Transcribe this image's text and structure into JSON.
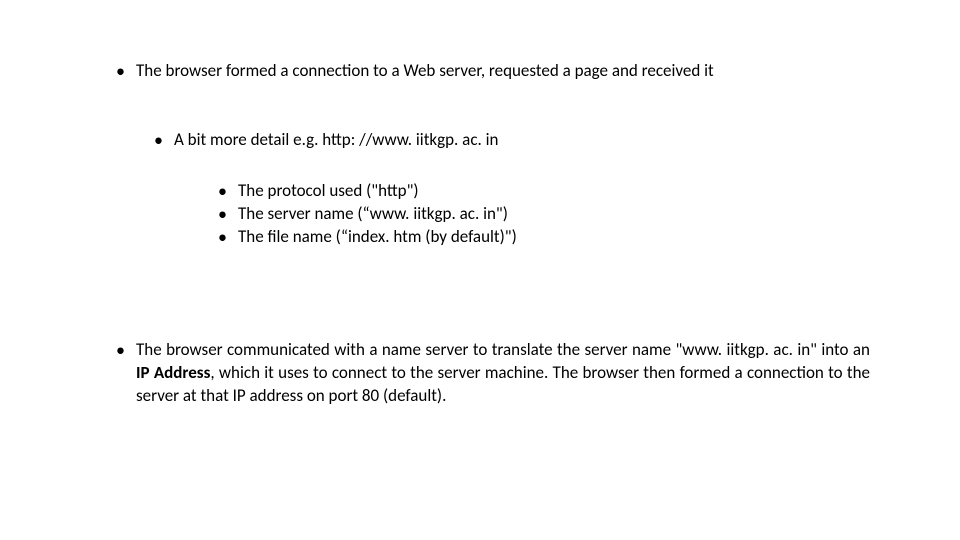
{
  "content": {
    "bullet1": "The browser formed a connection to a Web server, requested a page and received it",
    "sub1": "A bit more detail e.g. http: //www. iitkgp. ac. in",
    "subsub": {
      "a": "The protocol used (\"http\")",
      "b": "The server name (“www. iitkgp. ac. in\")",
      "c": "The file name (“index. htm (by default)\")"
    },
    "bullet2": {
      "pre": "The browser communicated with a name server to translate the server name \"www. iitkgp. ac. in\" into an ",
      "bold": "IP Address",
      "post": ", which it uses to connect to the server machine. The browser then formed a connection to the server at that IP address on port 80 (default)."
    }
  }
}
